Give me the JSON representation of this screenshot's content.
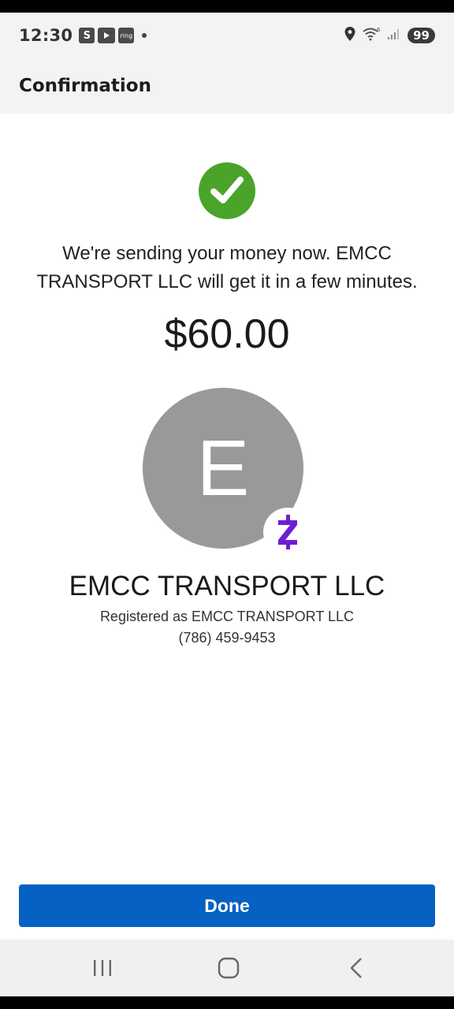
{
  "status_bar": {
    "time": "12:30",
    "app_icons": [
      "S",
      "youtube-icon",
      "ring"
    ],
    "battery": "99",
    "icons": [
      "location-icon",
      "wifi-icon",
      "signal-icon"
    ]
  },
  "app_bar": {
    "title": "Confirmation"
  },
  "confirmation": {
    "message": "We're sending your money now. EMCC TRANSPORT LLC will get it in a few minutes.",
    "amount": "$60.00"
  },
  "recipient": {
    "initial": "E",
    "name": "EMCC TRANSPORT LLC",
    "registered_as": "Registered as EMCC TRANSPORT LLC",
    "phone": "(786) 459-9453",
    "badge_icon": "zelle-icon"
  },
  "actions": {
    "done_label": "Done"
  },
  "colors": {
    "success_green": "#4aa42a",
    "primary_blue": "#0561c2",
    "zelle_purple": "#6d1ed4",
    "avatar_gray": "#999999"
  }
}
